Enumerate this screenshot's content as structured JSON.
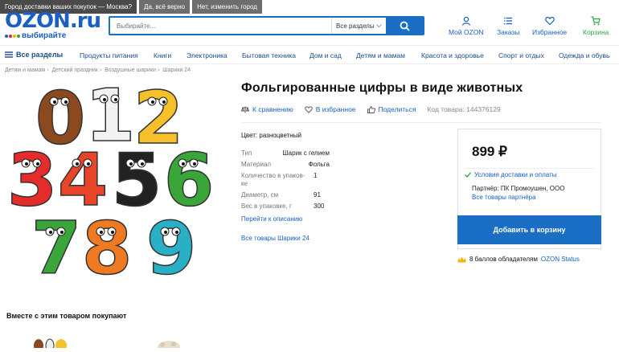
{
  "topbar": {
    "question": "Город доставки ваших покупок — Москва?",
    "yes": "Да, всё верно",
    "no": "Нет, изменить город"
  },
  "logo": {
    "word": "OZON.ru",
    "slogan": "выбирайте",
    "colors": [
      "#1a5fc1",
      "#e8232b",
      "#f7b500",
      "#2ba643"
    ]
  },
  "search": {
    "placeholder": "Выбирайте...",
    "section": "Все разделы"
  },
  "header_icons": [
    {
      "label": "Мой OZON",
      "icon": "user-icon"
    },
    {
      "label": "Заказы",
      "icon": "list-icon"
    },
    {
      "label": "Избранное",
      "icon": "heart-icon"
    },
    {
      "label": "Корзина",
      "icon": "cart-icon"
    }
  ],
  "catbar": {
    "all": "Все разделы",
    "items": [
      "Продукты питания",
      "Книги",
      "Электроника",
      "Бытовая техника",
      "Дом и сад",
      "Детям и мамам",
      "Красота и здоровье",
      "Спорт и отдых",
      "Одежда и обувь"
    ]
  },
  "breadcrumbs": [
    "Детям и мамам",
    "Детский праздник",
    "Воздушные шарики",
    "Шарики 24"
  ],
  "product": {
    "title": "Фольгированные цифры в виде животных",
    "compare": "К сравнению",
    "favorite": "В избранное",
    "share": "Поделиться",
    "code": "Код товара: 144376129",
    "color": "Цвет: разноцветный",
    "specs": [
      {
        "k": "Тип",
        "v": "Шарик с гелием"
      },
      {
        "k": "Материал",
        "v": "Фольга"
      },
      {
        "k": "Количество в упаков-ке",
        "v": "1"
      },
      {
        "k": "Диаметр, см",
        "v": "91"
      },
      {
        "k": "Вес в упаковке, г",
        "v": "300"
      }
    ],
    "to_description": "Перейти к описанию",
    "all_goods": "Все товары Шарики 24"
  },
  "buybox": {
    "price": "899 ₽",
    "delivery": "Условия доставки и оплаты",
    "partner": "Партнёр: ПК Промоушен, ООО",
    "partner_link": "Все товары партнёра",
    "cart_button": "Добавить в корзину"
  },
  "bonus": {
    "text": "8 баллов обладателям",
    "status": "OZON Status"
  },
  "together_title": "Вместе с этим товаром покупают",
  "balloon_digits": [
    "0",
    "1",
    "2",
    "3",
    "4",
    "5",
    "6",
    "7",
    "8",
    "9"
  ],
  "balloon_colors": [
    "#8b4a1e",
    "#f2f2f2",
    "#f5c02a",
    "#e62b2b",
    "#e8442a",
    "#222222",
    "#3aa63a",
    "#3aa63a",
    "#f07a22",
    "#2ab0c6"
  ],
  "accent_color": "#1a6fc4"
}
